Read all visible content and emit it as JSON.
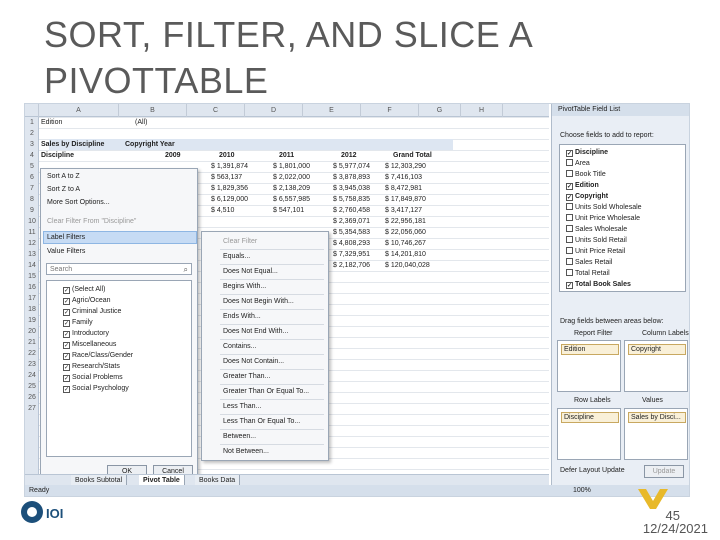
{
  "slide": {
    "title": "SORT, FILTER, AND SLICE A PIVOTTABLE",
    "page_number": "45",
    "date": "12/24/2021"
  },
  "sheet": {
    "columns": [
      "A",
      "B",
      "C",
      "D",
      "E",
      "F",
      "G",
      "H"
    ],
    "rows": [
      "1",
      "2",
      "3",
      "4",
      "5",
      "6",
      "7",
      "8",
      "9",
      "10",
      "11",
      "12",
      "13",
      "14",
      "15",
      "16",
      "17",
      "18",
      "19",
      "20",
      "21",
      "22",
      "23",
      "24",
      "25",
      "26",
      "27"
    ],
    "filter_field": "Edition",
    "filter_value": "(All)",
    "measure_label": "Sales by Discipline",
    "col_field": "Copyright Year",
    "row_field": "Discipline",
    "year_headers": [
      "2009",
      "2010",
      "2011",
      "2012",
      "Grand Total"
    ],
    "values": [
      [
        "$ 1,391,874",
        "$ 1,801,000",
        "$ 5,977,074",
        "$ 12,303,290"
      ],
      [
        "$ 563,137",
        "$ 2,022,000",
        "$ 3,878,893",
        "$ 7,416,103"
      ],
      [
        "$ 1,829,356",
        "$ 2,138,209",
        "$ 3,945,038",
        "$ 8,472,981"
      ],
      [
        "$ 6,129,000",
        "$ 6,557,985",
        "$ 5,758,835",
        "$ 17,849,870"
      ],
      [
        "$ 4,510",
        "$ 547,101",
        "$ 2,760,458",
        "$ 3,417,127"
      ],
      [
        "",
        "",
        "$ 2,369,071",
        "$ 22,956,181"
      ],
      [
        "",
        "",
        "$ 5,354,583",
        "$ 22,056,060"
      ],
      [
        "",
        "",
        "$ 4,808,293",
        "$ 10,746,267"
      ],
      [
        "",
        "",
        "$ 7,329,951",
        "$ 14,201,810"
      ],
      [
        "",
        "",
        "$ 2,182,706",
        "$ 120,040,028"
      ]
    ]
  },
  "context_menu": {
    "items": [
      "Sort A to Z",
      "Sort Z to A",
      "More Sort Options...",
      "Clear Filter From \"Discipline\"",
      "Label Filters",
      "Value Filters"
    ],
    "search_placeholder": "Search",
    "checklist": [
      "(Select All)",
      "Agric/Ocean",
      "Criminal Justice",
      "Family",
      "Introductory",
      "Miscellaneous",
      "Race/Class/Gender",
      "Research/Stats",
      "Social Problems",
      "Social Psychology"
    ],
    "ok": "OK",
    "cancel": "Cancel"
  },
  "submenu": {
    "items": [
      "Clear Filter",
      "Equals...",
      "Does Not Equal...",
      "Begins With...",
      "Does Not Begin With...",
      "Ends With...",
      "Does Not End With...",
      "Contains...",
      "Does Not Contain...",
      "Greater Than...",
      "Greater Than Or Equal To...",
      "Less Than...",
      "Less Than Or Equal To...",
      "Between...",
      "Not Between..."
    ]
  },
  "field_list": {
    "title": "PivotTable Field List",
    "prompt": "Choose fields to add to report:",
    "fields": [
      {
        "name": "Discipline",
        "checked": true,
        "bold": true
      },
      {
        "name": "Area",
        "checked": false,
        "bold": false
      },
      {
        "name": "Book Title",
        "checked": false,
        "bold": false
      },
      {
        "name": "Edition",
        "checked": true,
        "bold": true
      },
      {
        "name": "Copyright",
        "checked": true,
        "bold": true
      },
      {
        "name": "Units Sold Wholesale",
        "checked": false,
        "bold": false
      },
      {
        "name": "Unit Price Wholesale",
        "checked": false,
        "bold": false
      },
      {
        "name": "Sales Wholesale",
        "checked": false,
        "bold": false
      },
      {
        "name": "Units Sold Retail",
        "checked": false,
        "bold": false
      },
      {
        "name": "Unit Price Retail",
        "checked": false,
        "bold": false
      },
      {
        "name": "Sales Retail",
        "checked": false,
        "bold": false
      },
      {
        "name": "Total Retail",
        "checked": false,
        "bold": false
      },
      {
        "name": "Total Book Sales",
        "checked": true,
        "bold": true
      }
    ],
    "drag_label": "Drag fields between areas below:",
    "report_filter_label": "Report Filter",
    "column_labels_label": "Column Labels",
    "row_labels_label": "Row Labels",
    "values_label": "Values",
    "report_filter_chip": "Edition",
    "column_chip": "Copyright",
    "row_chip": "Discipline",
    "values_chip": "Sales by Disci...",
    "defer_label": "Defer Layout Update",
    "update": "Update"
  },
  "sheet_tabs": [
    "Books Subtotal",
    "Pivot Table",
    "Books Data"
  ],
  "status": {
    "text": "Ready",
    "zoom": "100%"
  }
}
